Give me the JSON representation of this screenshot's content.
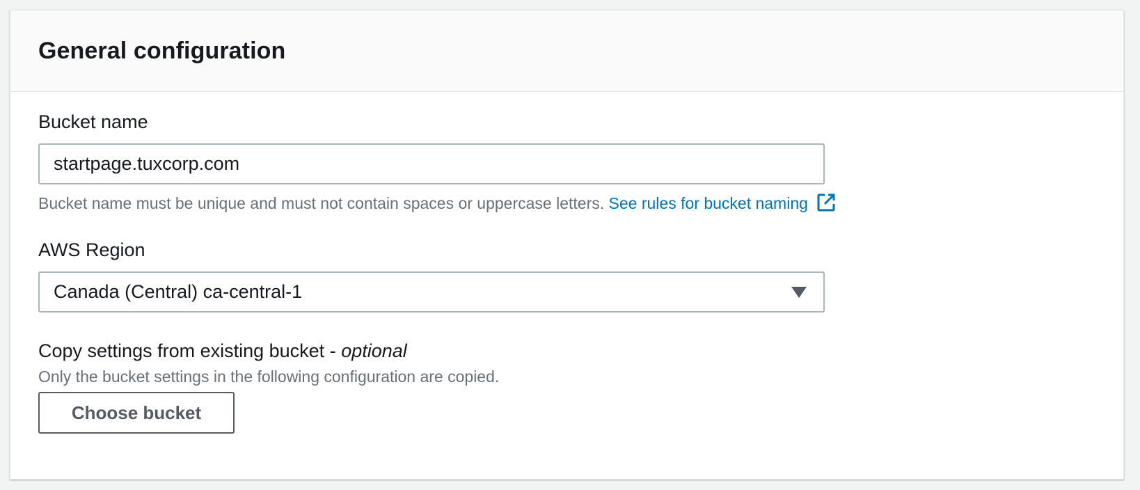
{
  "general_configuration": {
    "title": "General configuration",
    "bucket_name": {
      "label": "Bucket name",
      "value": "startpage.tuxcorp.com",
      "hint": "Bucket name must be unique and must not contain spaces or uppercase letters.",
      "link_label": "See rules for bucket naming",
      "link_icon": "external-link-icon"
    },
    "aws_region": {
      "label": "AWS Region",
      "selected": "Canada (Central) ca-central-1",
      "arrow_icon": "caret-down-icon"
    },
    "copy_settings": {
      "label": "Copy settings from existing bucket - ",
      "label_optional": "optional",
      "description": "Only the bucket settings in the following configuration are copied.",
      "button_label": "Choose bucket"
    }
  },
  "colors": {
    "link": "#0073bb",
    "text": "#16191f",
    "hint": "#687078",
    "border": "#aab7b8",
    "button_border": "#545b64"
  }
}
